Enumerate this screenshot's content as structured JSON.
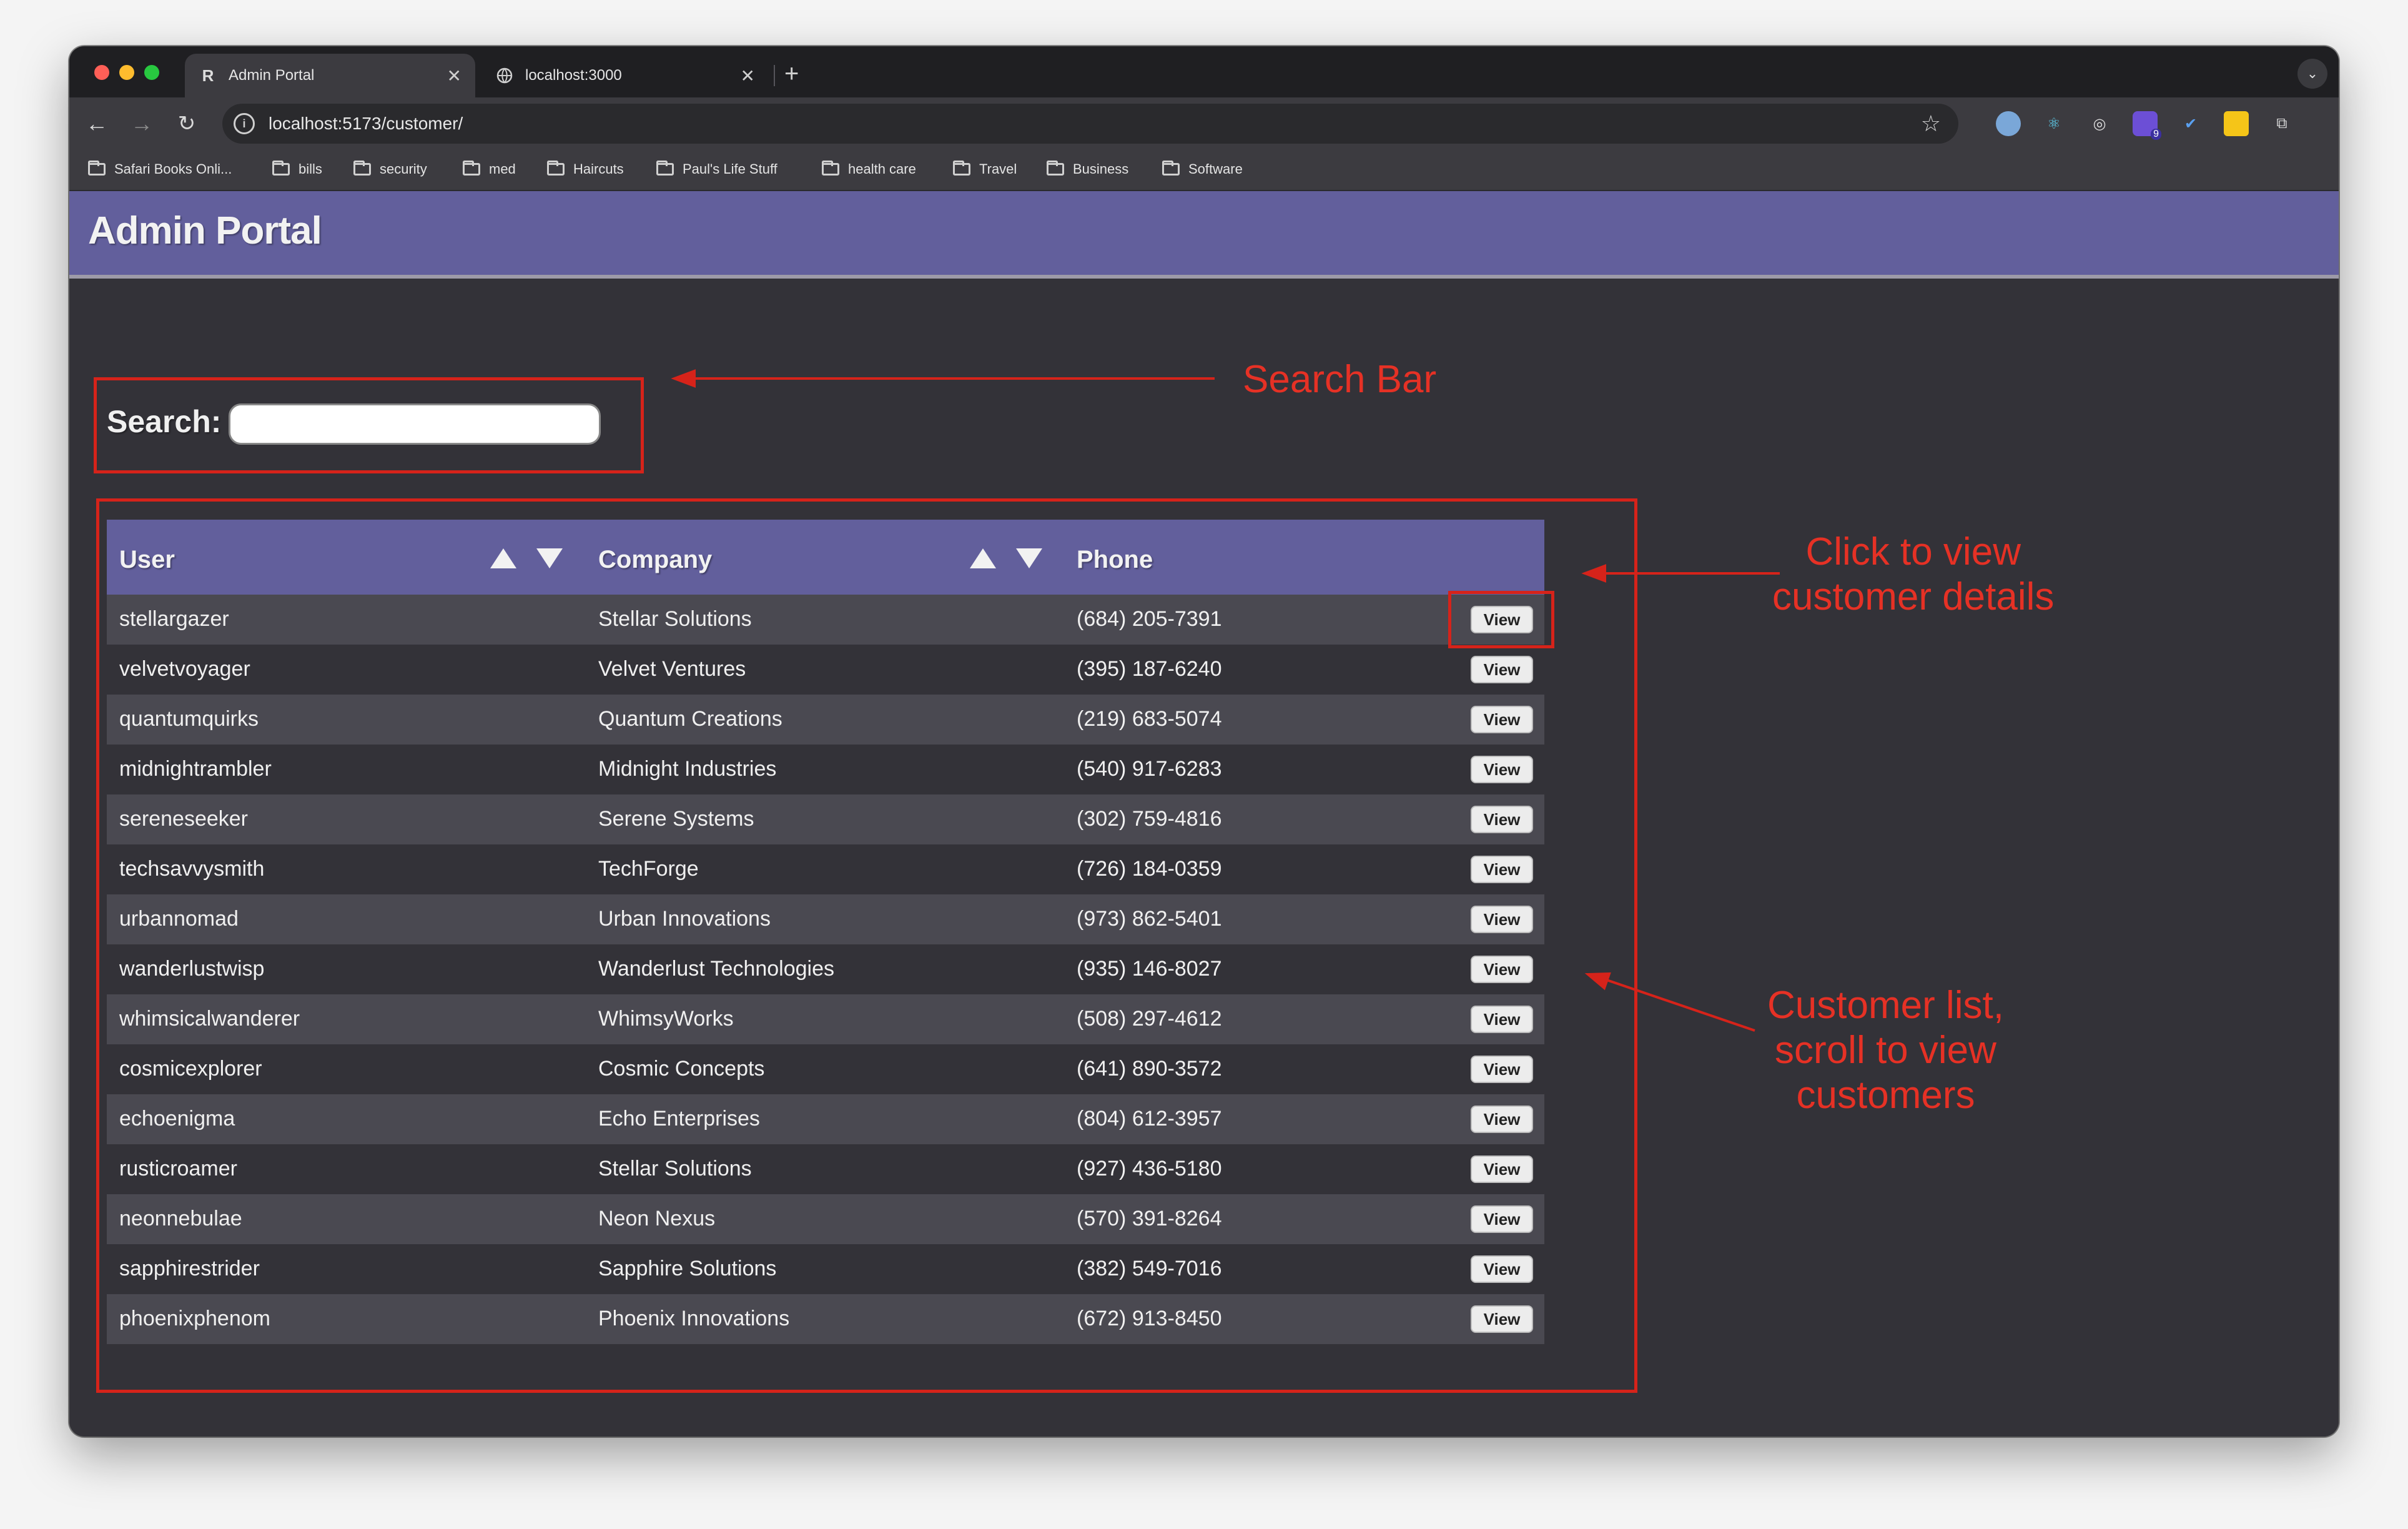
{
  "browser": {
    "tabs": [
      {
        "title": "Admin Portal",
        "favicon": "R",
        "active": true
      },
      {
        "title": "localhost:3000",
        "favicon": "globe-icon",
        "active": false
      }
    ],
    "url": "localhost:5173/customer/",
    "bookmarks": [
      "Safari Books Onli...",
      "bills",
      "security",
      "med",
      "Haircuts",
      "Paul's Life Stuff",
      "health care",
      "Travel",
      "Business",
      "Software"
    ],
    "extension_badge": "9"
  },
  "app": {
    "title": "Admin Portal",
    "search_label": "Search:",
    "search_value": "",
    "columns": {
      "user": "User",
      "company": "Company",
      "phone": "Phone"
    },
    "view_label": "View",
    "customers": [
      {
        "user": "stellargazer",
        "company": "Stellar Solutions",
        "phone": "(684) 205-7391"
      },
      {
        "user": "velvetvoyager",
        "company": "Velvet Ventures",
        "phone": "(395) 187-6240"
      },
      {
        "user": "quantumquirks",
        "company": "Quantum Creations",
        "phone": "(219) 683-5074"
      },
      {
        "user": "midnightrambler",
        "company": "Midnight Industries",
        "phone": "(540) 917-6283"
      },
      {
        "user": "sereneseeker",
        "company": "Serene Systems",
        "phone": "(302) 759-4816"
      },
      {
        "user": "techsavvysmith",
        "company": "TechForge",
        "phone": "(726) 184-0359"
      },
      {
        "user": "urbannomad",
        "company": "Urban Innovations",
        "phone": "(973) 862-5401"
      },
      {
        "user": "wanderlustwisp",
        "company": "Wanderlust Technologies",
        "phone": "(935) 146-8027"
      },
      {
        "user": "whimsicalwanderer",
        "company": "WhimsyWorks",
        "phone": "(508) 297-4612"
      },
      {
        "user": "cosmicexplorer",
        "company": "Cosmic Concepts",
        "phone": "(641) 890-3572"
      },
      {
        "user": "echoenigma",
        "company": "Echo Enterprises",
        "phone": "(804) 612-3957"
      },
      {
        "user": "rusticroamer",
        "company": "Stellar Solutions",
        "phone": "(927) 436-5180"
      },
      {
        "user": "neonnebulae",
        "company": "Neon Nexus",
        "phone": "(570) 391-8264"
      },
      {
        "user": "sapphirestrider",
        "company": "Sapphire Solutions",
        "phone": "(382) 549-7016"
      },
      {
        "user": "phoenixphenom",
        "company": "Phoenix Innovations",
        "phone": "(672) 913-8450"
      }
    ]
  },
  "annotations": {
    "search": "Search Bar",
    "view": [
      "Click to view",
      "customer details"
    ],
    "list": [
      "Customer list,",
      "scroll to view",
      "customers"
    ]
  },
  "colors": {
    "header": "#625f9c",
    "page_bg": "#333238",
    "row_alt": "#4a4951",
    "annotation": "#e63125"
  }
}
